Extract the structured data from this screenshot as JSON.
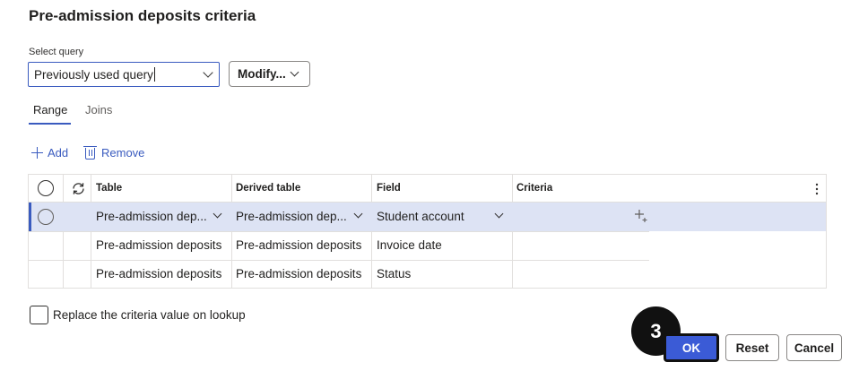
{
  "dialog": {
    "title": "Pre-admission deposits criteria"
  },
  "query": {
    "label": "Select query",
    "value": "Previously used query",
    "modify_label": "Modify..."
  },
  "tabs": [
    {
      "label": "Range",
      "active": true
    },
    {
      "label": "Joins",
      "active": false
    }
  ],
  "actions": {
    "add_label": "Add",
    "remove_label": "Remove"
  },
  "grid": {
    "columns": [
      "Table",
      "Derived table",
      "Field",
      "Criteria"
    ],
    "rows": [
      {
        "table": "Pre-admission dep...",
        "derived_table": "Pre-admission dep...",
        "field": "Student account",
        "criteria": "",
        "selected": true
      },
      {
        "table": "Pre-admission deposits",
        "derived_table": "Pre-admission deposits",
        "field": "Invoice date",
        "criteria": "",
        "selected": false
      },
      {
        "table": "Pre-admission deposits",
        "derived_table": "Pre-admission deposits",
        "field": "Status",
        "criteria": "",
        "selected": false
      }
    ]
  },
  "options": {
    "replace_label": "Replace the criteria value on lookup",
    "replace_checked": false
  },
  "step_badge": "3",
  "buttons": {
    "ok": "OK",
    "reset": "Reset",
    "cancel": "Cancel"
  },
  "colors": {
    "accent": "#3a5bbf",
    "selected_row": "#dde3f4",
    "ok_button": "#3b5bd6"
  },
  "icons": [
    "chevron-down-icon",
    "add-icon",
    "trash-icon",
    "refresh-icon",
    "more-vertical-icon",
    "crosshair-icon"
  ]
}
